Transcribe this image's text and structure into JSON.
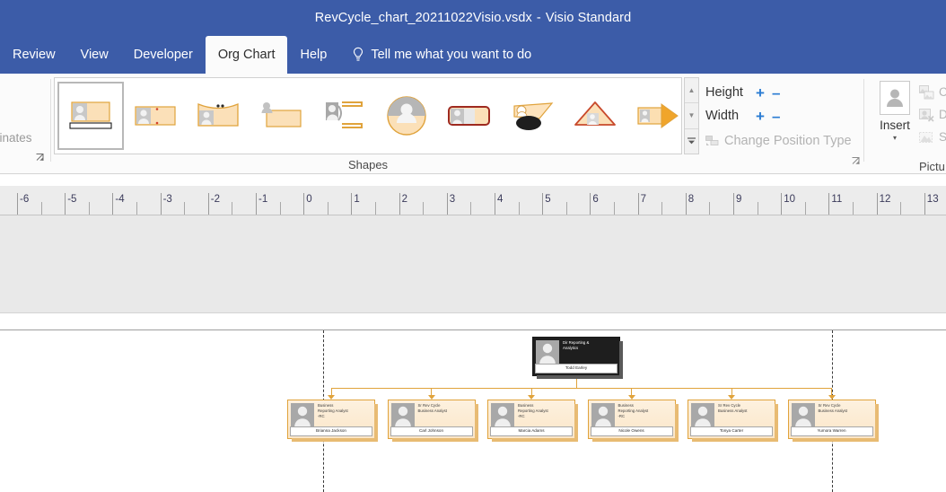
{
  "app": {
    "titlebar": {
      "document_name": "RevCycle_chart_20211022Visio.vsdx",
      "separator": "-",
      "product": "Visio Standard"
    }
  },
  "ribbon": {
    "tabs": [
      {
        "label": "Review",
        "active": false
      },
      {
        "label": "View",
        "active": false
      },
      {
        "label": "Developer",
        "active": false
      },
      {
        "label": "Org Chart",
        "active": true
      },
      {
        "label": "Help",
        "active": false
      }
    ],
    "tell_me": {
      "label": "Tell me what you want to do",
      "icon": "lightbulb-icon"
    },
    "groups": {
      "truncated_left": {
        "label": "dinates"
      },
      "shapes": {
        "label": "Shapes",
        "items": [
          {
            "name": "belt-shape",
            "selected": true
          },
          {
            "name": "block-shape",
            "selected": false
          },
          {
            "name": "wave-shape",
            "selected": false
          },
          {
            "name": "stacked-shape",
            "selected": false
          },
          {
            "name": "brackets-shape",
            "selected": false
          },
          {
            "name": "circle-shape",
            "selected": false
          },
          {
            "name": "rounded-rect-shape",
            "selected": false
          },
          {
            "name": "panel-shape",
            "selected": false
          },
          {
            "name": "triangle-shape",
            "selected": false
          },
          {
            "name": "arrow-shape",
            "selected": false
          }
        ],
        "scroll_up": "▲",
        "scroll_down": "▼",
        "more": "▼"
      },
      "size": {
        "height_label": "Height",
        "width_label": "Width",
        "plus": "+",
        "minus": "–",
        "change_position_type": "Change Position Type"
      },
      "picture": {
        "label": "Pictu",
        "insert_label": "Insert",
        "insert_caret": "▾",
        "items": [
          {
            "label": "Ch",
            "icon": "change-picture-icon"
          },
          {
            "label": "D",
            "icon": "delete-picture-icon"
          },
          {
            "label": "Sh",
            "icon": "show-picture-icon"
          }
        ]
      }
    }
  },
  "ruler": {
    "labels": [
      "-6",
      "-5",
      "-4",
      "-3",
      "-2",
      "-1",
      "0",
      "1",
      "2",
      "3",
      "4",
      "5",
      "6",
      "7",
      "8",
      "9",
      "10",
      "11",
      "12",
      "13"
    ],
    "origin_label": "0",
    "units": "inches"
  },
  "chart_data": {
    "type": "diagram",
    "diagram_type": "org-chart",
    "title": "RevCycle_chart_20211022Visio",
    "root": {
      "title_line1": "Dir Reporting &",
      "title_line2": "Analytics",
      "name": "Todd Earley"
    },
    "children": [
      {
        "title_line1": "Business",
        "title_line2": "Reporting Analyst",
        "title_line3": "-RC",
        "name": "Brianna Jackson"
      },
      {
        "title_line1": "Sr Rev Cycle",
        "title_line2": "Business Analyst",
        "title_line3": "",
        "name": "Carl Johnson"
      },
      {
        "title_line1": "Business",
        "title_line2": "Reporting Analyst",
        "title_line3": "-RC",
        "name": "Marcia Adams"
      },
      {
        "title_line1": "Business",
        "title_line2": "Reporting Analyst",
        "title_line3": "-RC",
        "name": "Nicole Owens"
      },
      {
        "title_line1": "Sr Rev Cycle",
        "title_line2": "Business Analyst",
        "title_line3": "",
        "name": "Tonya Carter"
      },
      {
        "title_line1": "Sr Rev Cycle",
        "title_line2": "Business Analyst",
        "title_line3": "",
        "name": "Yumora Warren"
      }
    ]
  },
  "colors": {
    "titlebar_blue": "#3c5ca8",
    "ribbon_bg": "#fbfbfb",
    "accent_blue": "#2b7cd3",
    "node_border_orange": "#e0a33c",
    "node_fill_orange": "#fbe6c8",
    "root_fill_dark": "#1e1e1e",
    "canvas_gray": "#e9e9e9",
    "ruler_bg": "#ececec"
  }
}
